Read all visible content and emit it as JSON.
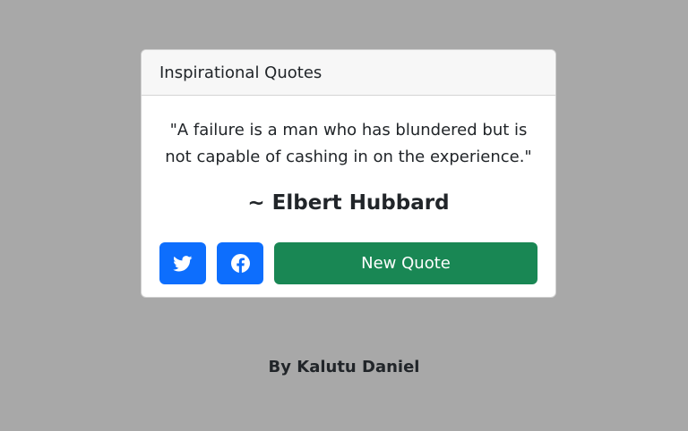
{
  "card": {
    "header_title": "Inspirational Quotes",
    "quote_text": "\"A failure is a man who has blundered but is not capable of cashing in on the experience.\"",
    "author": "~ Elbert Hubbard"
  },
  "actions": {
    "twitter_icon": "twitter-icon",
    "facebook_icon": "facebook-icon",
    "new_quote_label": "New Quote"
  },
  "footer": {
    "credit": "By Kalutu Daniel"
  },
  "colors": {
    "background": "#a8a8a8",
    "social_button": "#0d6efd",
    "new_quote_button": "#198754"
  }
}
